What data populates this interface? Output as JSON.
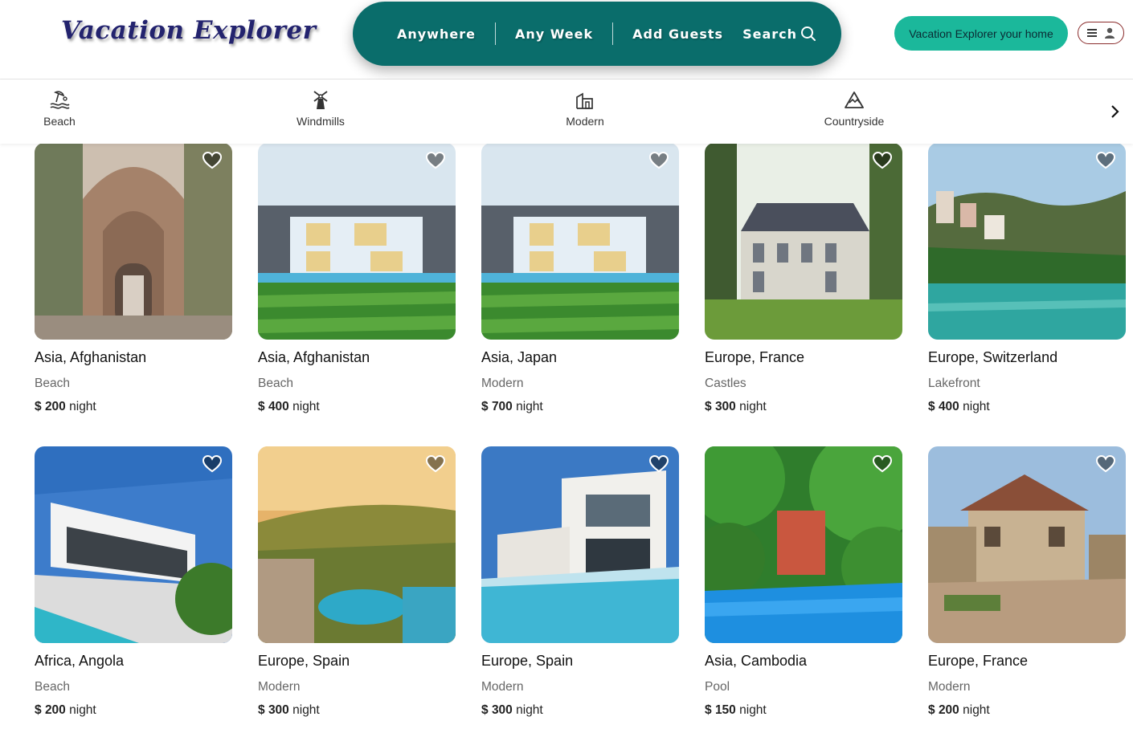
{
  "header": {
    "logo": "Vacation Explorer",
    "search": {
      "anywhere": "Anywhere",
      "any_week": "Any Week",
      "add_guests": "Add Guests",
      "search_label": "Search"
    },
    "host_button": "Vacation Explorer your home",
    "menu_icons": [
      "menu-icon",
      "user-icon"
    ]
  },
  "categories": [
    {
      "label": "Beach",
      "icon": "beach-icon"
    },
    {
      "label": "Windmills",
      "icon": "windmill-icon"
    },
    {
      "label": "Modern",
      "icon": "modern-building-icon"
    },
    {
      "label": "Countryside",
      "icon": "mountain-icon"
    }
  ],
  "listings": [
    {
      "location": "Asia, Afghanistan",
      "category": "Beach",
      "currency": "$",
      "price": "200",
      "unit": "night"
    },
    {
      "location": "Asia, Afghanistan",
      "category": "Beach",
      "currency": "$",
      "price": "400",
      "unit": "night"
    },
    {
      "location": "Asia, Japan",
      "category": "Modern",
      "currency": "$",
      "price": "700",
      "unit": "night"
    },
    {
      "location": "Europe, France",
      "category": "Castles",
      "currency": "$",
      "price": "300",
      "unit": "night"
    },
    {
      "location": "Europe, Switzerland",
      "category": "Lakefront",
      "currency": "$",
      "price": "400",
      "unit": "night"
    },
    {
      "location": "Africa, Angola",
      "category": "Beach",
      "currency": "$",
      "price": "200",
      "unit": "night"
    },
    {
      "location": "Europe, Spain",
      "category": "Modern",
      "currency": "$",
      "price": "300",
      "unit": "night"
    },
    {
      "location": "Europe, Spain",
      "category": "Modern",
      "currency": "$",
      "price": "300",
      "unit": "night"
    },
    {
      "location": "Asia, Cambodia",
      "category": "Pool",
      "currency": "$",
      "price": "150",
      "unit": "night"
    },
    {
      "location": "Europe, France",
      "category": "Modern",
      "currency": "$",
      "price": "200",
      "unit": "night"
    }
  ],
  "colors": {
    "search_bg": "#0a6d6b",
    "host_btn_bg": "#1bb89b",
    "logo": "#23236e"
  }
}
